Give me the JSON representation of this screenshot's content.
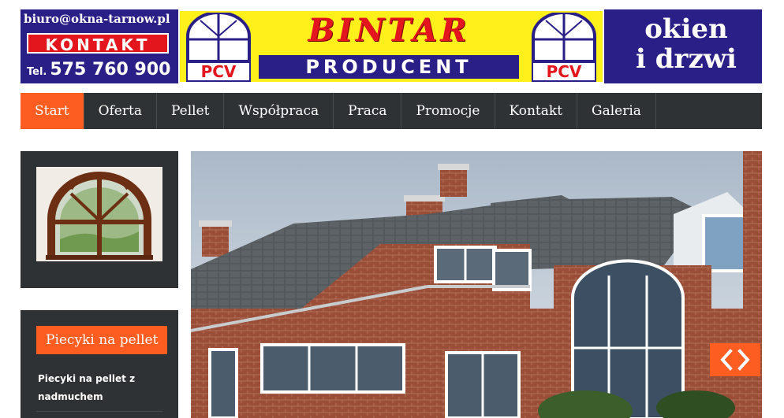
{
  "banner": {
    "email": "biuro@okna-tarnow.pl",
    "kontakt": "KONTAKT",
    "phone_prefix": "Tel.",
    "phone_number": "575 760 900",
    "brand": "BINTAR",
    "subtitle": "PRODUCENT",
    "pcv_left": "PCV",
    "pcv_right": "PCV",
    "tagline_line1": "okien",
    "tagline_line2": "i drzwi",
    "colors": {
      "navy": "#2a1f86",
      "yellow": "#ffef1a",
      "red": "#e3161d"
    }
  },
  "nav": {
    "items": [
      {
        "label": "Start",
        "active": true
      },
      {
        "label": "Oferta"
      },
      {
        "label": "Pellet"
      },
      {
        "label": "Współpraca"
      },
      {
        "label": "Praca"
      },
      {
        "label": "Promocje"
      },
      {
        "label": "Kontakt"
      },
      {
        "label": "Galeria"
      }
    ],
    "colors": {
      "bar": "#2e3235",
      "active": "#fd5d21"
    }
  },
  "sidebar": {
    "image_widget": {
      "icon": "arched-window-photo"
    },
    "pellet_widget": {
      "title": "Piecyki na pellet",
      "link": "Piecyki na pellet z nadmuchem"
    }
  },
  "slider": {
    "image": "brick-house-photo",
    "arrows_icon": "slider-arrows-icon"
  }
}
